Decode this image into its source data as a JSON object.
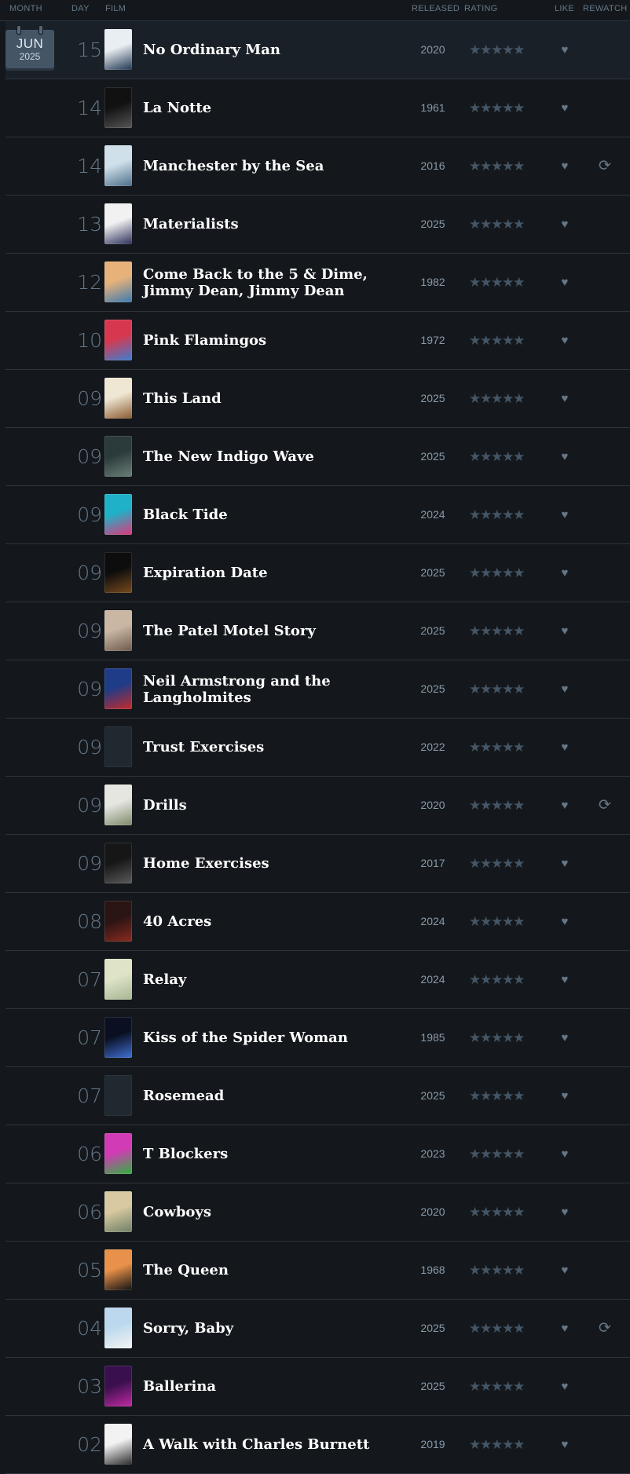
{
  "columns": {
    "month": "MONTH",
    "day": "DAY",
    "film": "FILM",
    "released": "RELEASED",
    "rating": "RATING",
    "like": "LIKE",
    "rewatch": "REWATCH"
  },
  "calendar": {
    "month": "JUN",
    "year": "2025"
  },
  "icons": {
    "stars": "★★★★★",
    "like": "♥",
    "rewatch": "⟳"
  },
  "colors": {
    "background": "#14181c",
    "divider": "#2c3440",
    "title": "#ffffff",
    "muted": "#667788"
  },
  "entries": [
    {
      "day": "15",
      "title": "No Ordinary Man",
      "year": "2020",
      "rewatch": false,
      "poster": [
        "#e9eef2",
        "#1f3550"
      ]
    },
    {
      "day": "14",
      "title": "La Notte",
      "year": "1961",
      "rewatch": false,
      "poster": [
        "#111111",
        "#555555"
      ]
    },
    {
      "day": "14",
      "title": "Manchester by the Sea",
      "year": "2016",
      "rewatch": true,
      "poster": [
        "#cfe0ea",
        "#4c6f8a"
      ]
    },
    {
      "day": "13",
      "title": "Materialists",
      "year": "2025",
      "rewatch": false,
      "poster": [
        "#f1f1f1",
        "#2b2f5a"
      ]
    },
    {
      "day": "12",
      "title": "Come Back to the 5 & Dime, Jimmy Dean, Jimmy Dean",
      "year": "1982",
      "rewatch": false,
      "poster": [
        "#e7b27a",
        "#3b7ab0"
      ]
    },
    {
      "day": "10",
      "title": "Pink Flamingos",
      "year": "1972",
      "rewatch": false,
      "poster": [
        "#d8384f",
        "#3a7fd0"
      ]
    },
    {
      "day": "09",
      "title": "This Land",
      "year": "2025",
      "rewatch": false,
      "poster": [
        "#efe6d4",
        "#8a5a2f"
      ]
    },
    {
      "day": "09",
      "title": "The New Indigo Wave",
      "year": "2025",
      "rewatch": false,
      "poster": [
        "#2b3a3a",
        "#6a7f78"
      ]
    },
    {
      "day": "09",
      "title": "Black Tide",
      "year": "2024",
      "rewatch": false,
      "poster": [
        "#1fb1c7",
        "#e0377a"
      ]
    },
    {
      "day": "09",
      "title": "Expiration Date",
      "year": "2025",
      "rewatch": false,
      "poster": [
        "#0d0d0d",
        "#7a4a1c"
      ]
    },
    {
      "day": "09",
      "title": "The Patel Motel Story",
      "year": "2025",
      "rewatch": false,
      "poster": [
        "#c9b7a4",
        "#6e5a4c"
      ]
    },
    {
      "day": "09",
      "title": "Neil Armstrong and the Langholmites",
      "year": "2025",
      "rewatch": false,
      "poster": [
        "#1f3c88",
        "#c52a2a"
      ]
    },
    {
      "day": "09",
      "title": "Trust Exercises",
      "year": "2022",
      "rewatch": false,
      "poster": null
    },
    {
      "day": "09",
      "title": "Drills",
      "year": "2020",
      "rewatch": true,
      "poster": [
        "#e6e6e1",
        "#7d8a6a"
      ]
    },
    {
      "day": "09",
      "title": "Home Exercises",
      "year": "2017",
      "rewatch": false,
      "poster": [
        "#161616",
        "#5a5a5a"
      ]
    },
    {
      "day": "08",
      "title": "40 Acres",
      "year": "2024",
      "rewatch": false,
      "poster": [
        "#2a1414",
        "#8a2a1f"
      ]
    },
    {
      "day": "07",
      "title": "Relay",
      "year": "2024",
      "rewatch": false,
      "poster": [
        "#dfe3c7",
        "#a6b693"
      ]
    },
    {
      "day": "07",
      "title": "Kiss of the Spider Woman",
      "year": "1985",
      "rewatch": false,
      "poster": [
        "#0a1022",
        "#3f6fd3"
      ]
    },
    {
      "day": "07",
      "title": "Rosemead",
      "year": "2025",
      "rewatch": false,
      "poster": null
    },
    {
      "day": "06",
      "title": "T Blockers",
      "year": "2023",
      "rewatch": false,
      "poster": [
        "#d13bb5",
        "#2fb13f"
      ]
    },
    {
      "day": "06",
      "title": "Cowboys",
      "year": "2020",
      "rewatch": false,
      "poster": [
        "#d8c9a0",
        "#6e7f66"
      ]
    },
    {
      "day": "05",
      "title": "The Queen",
      "year": "1968",
      "rewatch": false,
      "poster": [
        "#e8914a",
        "#111111"
      ]
    },
    {
      "day": "04",
      "title": "Sorry, Baby",
      "year": "2025",
      "rewatch": true,
      "poster": [
        "#bcd8ee",
        "#f4f4f4"
      ]
    },
    {
      "day": "03",
      "title": "Ballerina",
      "year": "2025",
      "rewatch": false,
      "poster": [
        "#3a0f4d",
        "#c02aa3"
      ]
    },
    {
      "day": "02",
      "title": "A Walk with Charles Burnett",
      "year": "2019",
      "rewatch": false,
      "poster": [
        "#f2f2f2",
        "#2a2a2a"
      ]
    }
  ]
}
